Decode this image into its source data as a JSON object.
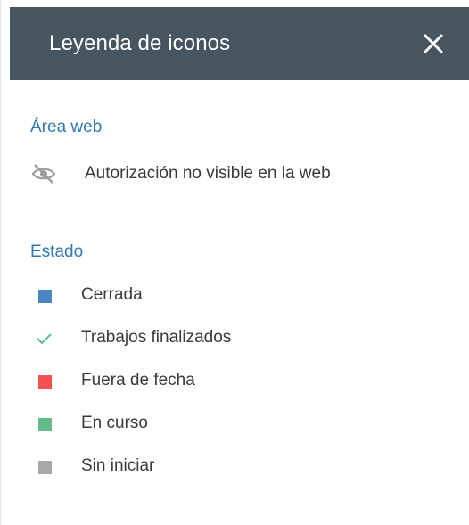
{
  "header": {
    "title": "Leyenda de iconos",
    "close_icon": "close-icon",
    "background": "#46555f"
  },
  "sections": {
    "web": {
      "title": "Área web",
      "items": [
        {
          "label": "Autorización no visible en la web",
          "icon": "eye-off-icon"
        }
      ]
    },
    "estado": {
      "title": "Estado",
      "items": [
        {
          "label": "Cerrada",
          "icon": "closed-square-icon",
          "color": "#4a86c4"
        },
        {
          "label": "Trabajos finalizados",
          "icon": "check-icon",
          "color": "#5fbf8f"
        },
        {
          "label": "Fuera de fecha",
          "icon": "overdue-square-icon",
          "color": "#f25252"
        },
        {
          "label": "En curso",
          "icon": "in-progress-square-icon",
          "color": "#63bb88"
        },
        {
          "label": "Sin iniciar",
          "icon": "not-started-square-icon",
          "color": "#a8a8a8"
        }
      ]
    }
  },
  "colors": {
    "section_title": "#2f78b3",
    "text": "#3a3a3a"
  }
}
